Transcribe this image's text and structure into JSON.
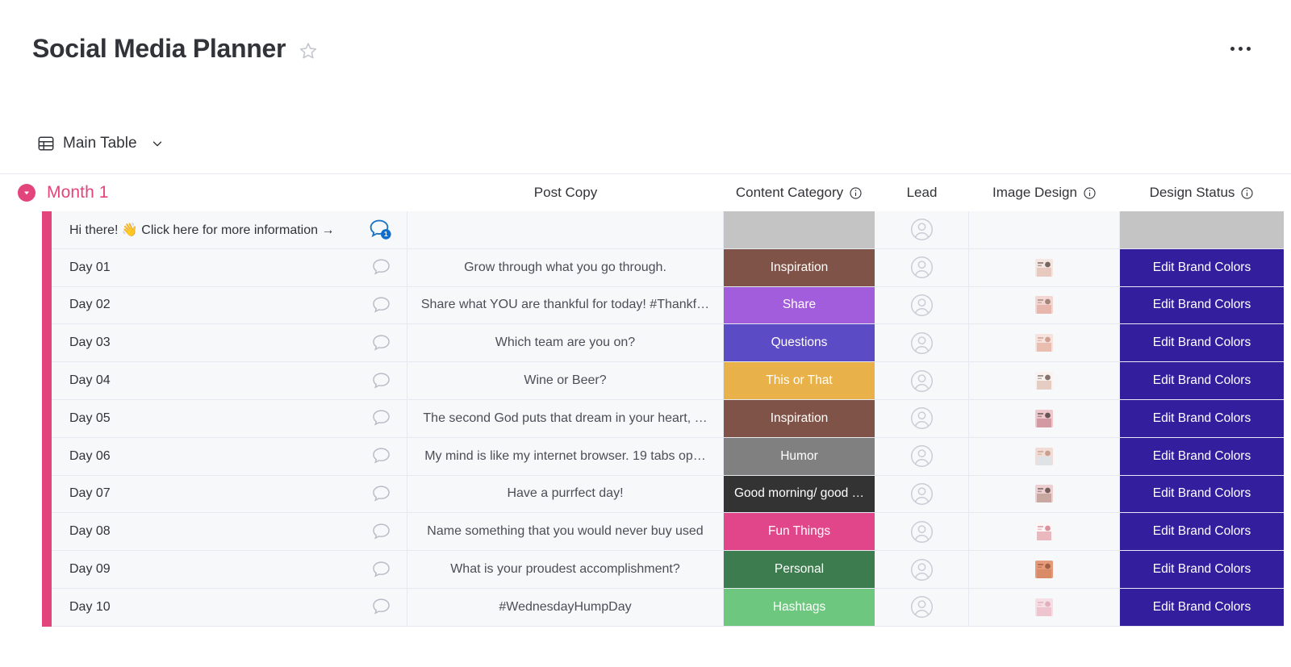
{
  "header": {
    "title": "Social Media Planner",
    "star_icon": "star-outline-icon",
    "menu_icon": "more-options-icon"
  },
  "tabs": [
    {
      "label": "Main Table",
      "icon": "table-grid-icon",
      "chevron": "chevron-down-icon"
    }
  ],
  "group": {
    "title": "Month 1",
    "color": "#e2447b",
    "collapse_icon": "collapse-group-icon"
  },
  "columns": [
    {
      "key": "name",
      "label": "",
      "info": false
    },
    {
      "key": "copy",
      "label": "Post Copy",
      "info": false
    },
    {
      "key": "category",
      "label": "Content Category",
      "info": true
    },
    {
      "key": "lead",
      "label": "Lead",
      "info": false
    },
    {
      "key": "image",
      "label": "Image Design",
      "info": true
    },
    {
      "key": "status",
      "label": "Design Status",
      "info": true
    }
  ],
  "category_colors": {
    "Inspiration": "#7f5347",
    "Share": "#a25ddc",
    "Questions": "#5b4bc4",
    "This or That": "#e8b14a",
    "Humor": "#808080",
    "Good morning/ good …": "#333333",
    "Fun Things": "#e2468a",
    "Personal": "#3d7c4f",
    "Hashtags": "#6ec77f",
    "empty": "#c4c4c4"
  },
  "status_color": "#331f9e",
  "rows": [
    {
      "name": "Hi there! 👋 Click here for more information →",
      "bubble": "badge",
      "bubble_count": "1",
      "copy": "",
      "category": "",
      "category_color": "#c4c4c4",
      "lead": "",
      "image": "",
      "status": "",
      "status_color": "#c4c4c4"
    },
    {
      "name": "Day 01",
      "bubble": "empty",
      "bubble_count": "",
      "copy": "Grow through what you go through.",
      "category": "Inspiration",
      "category_color": "#7f5347",
      "lead": "",
      "image": "thumb-01",
      "status": "Edit Brand Colors",
      "status_color": "#331f9e"
    },
    {
      "name": "Day 02",
      "bubble": "empty",
      "bubble_count": "",
      "copy": "Share what YOU are thankful for today! #Thankf…",
      "category": "Share",
      "category_color": "#a25ddc",
      "lead": "",
      "image": "thumb-02",
      "status": "Edit Brand Colors",
      "status_color": "#331f9e"
    },
    {
      "name": "Day 03",
      "bubble": "empty",
      "bubble_count": "",
      "copy": "Which team are you on?",
      "category": "Questions",
      "category_color": "#5b4bc4",
      "lead": "",
      "image": "thumb-03",
      "status": "Edit Brand Colors",
      "status_color": "#331f9e"
    },
    {
      "name": "Day 04",
      "bubble": "empty",
      "bubble_count": "",
      "copy": "Wine or Beer?",
      "category": "This or That",
      "category_color": "#e8b14a",
      "lead": "",
      "image": "thumb-04",
      "status": "Edit Brand Colors",
      "status_color": "#331f9e"
    },
    {
      "name": "Day 05",
      "bubble": "empty",
      "bubble_count": "",
      "copy": "The second God puts that dream in your heart, …",
      "category": "Inspiration",
      "category_color": "#7f5347",
      "lead": "",
      "image": "thumb-05",
      "status": "Edit Brand Colors",
      "status_color": "#331f9e"
    },
    {
      "name": "Day 06",
      "bubble": "empty",
      "bubble_count": "",
      "copy": "My mind is like my internet browser. 19 tabs op…",
      "category": "Humor",
      "category_color": "#808080",
      "lead": "",
      "image": "thumb-06",
      "status": "Edit Brand Colors",
      "status_color": "#331f9e"
    },
    {
      "name": "Day 07",
      "bubble": "empty",
      "bubble_count": "",
      "copy": "Have a purrfect day!",
      "category": "Good morning/ good …",
      "category_color": "#333333",
      "lead": "",
      "image": "thumb-07",
      "status": "Edit Brand Colors",
      "status_color": "#331f9e"
    },
    {
      "name": "Day 08",
      "bubble": "empty",
      "bubble_count": "",
      "copy": "Name something that you would never buy used",
      "category": "Fun Things",
      "category_color": "#e2468a",
      "lead": "",
      "image": "thumb-08",
      "status": "Edit Brand Colors",
      "status_color": "#331f9e"
    },
    {
      "name": "Day 09",
      "bubble": "empty",
      "bubble_count": "",
      "copy": "What is your proudest accomplishment?",
      "category": "Personal",
      "category_color": "#3d7c4f",
      "lead": "",
      "image": "thumb-09",
      "status": "Edit Brand Colors",
      "status_color": "#331f9e"
    },
    {
      "name": "Day 10",
      "bubble": "empty",
      "bubble_count": "",
      "copy": "#WednesdayHumpDay",
      "category": "Hashtags",
      "category_color": "#6ec77f",
      "lead": "",
      "image": "thumb-10",
      "status": "Edit Brand Colors",
      "status_color": "#331f9e"
    }
  ]
}
